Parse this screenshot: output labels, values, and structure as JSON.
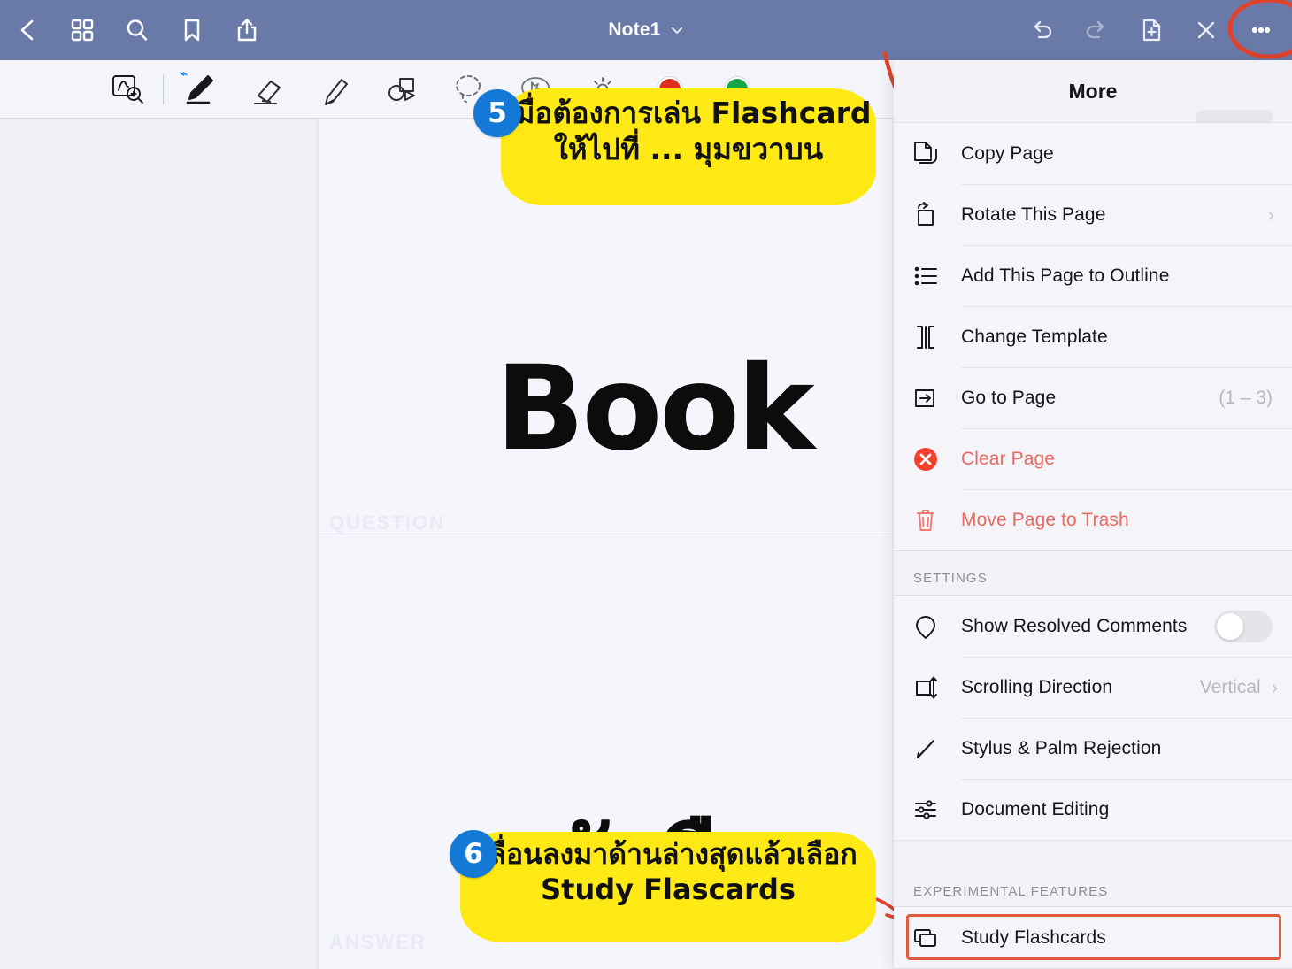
{
  "navbar": {
    "background": "#6a7aa8",
    "title": "Note1",
    "left_icons": [
      {
        "name": "back-icon",
        "label": "Back"
      },
      {
        "name": "grid-thumbnails-icon",
        "label": "Page Thumbnails"
      },
      {
        "name": "search-icon",
        "label": "Search"
      },
      {
        "name": "bookmark-icon",
        "label": "Bookmark"
      },
      {
        "name": "share-icon",
        "label": "Share"
      }
    ],
    "right_icons": [
      {
        "name": "undo-icon",
        "label": "Undo"
      },
      {
        "name": "redo-icon",
        "label": "Redo"
      },
      {
        "name": "add-page-icon",
        "label": "Add Page"
      },
      {
        "name": "close-tools-icon",
        "label": "Close"
      },
      {
        "name": "more-ellipsis-icon",
        "label": "More"
      }
    ]
  },
  "toolbar": {
    "background": "#f4f5f9",
    "tools": [
      {
        "name": "zoom-write-icon",
        "label": "Zoom Write"
      },
      {
        "name": "pen-icon",
        "label": "Pen",
        "badge": "bluetooth",
        "selected": true
      },
      {
        "name": "eraser-icon",
        "label": "Eraser"
      },
      {
        "name": "highlighter-icon",
        "label": "Highlighter"
      },
      {
        "name": "shapes-icon",
        "label": "Shapes"
      },
      {
        "name": "lasso-select-icon",
        "label": "Lasso Select"
      },
      {
        "name": "sticker-icon",
        "label": "Sticker"
      },
      {
        "name": "brightness-icon",
        "label": "Brightness"
      }
    ],
    "swatches": [
      {
        "name": "color-swatch-red",
        "color": "#e02d22"
      },
      {
        "name": "color-swatch-green",
        "color": "#13a84a"
      }
    ]
  },
  "page": {
    "question_label": "QUESTION",
    "answer_label": "ANSWER",
    "handwriting_front": "Book",
    "handwriting_back": "หนังสือ"
  },
  "annotations": {
    "accent_color": "#e05a3f",
    "highlight_color": "#ffe914",
    "badge_color": "#1479d6",
    "step5": {
      "number": "5",
      "line1": "เมื่อต้องการเล่น Flashcard",
      "line2": "ให้ไปที่ ... มุมขวาบน"
    },
    "step6": {
      "number": "6",
      "line1": "เลื่อนลงมาด้านล่างสุดแล้วเลือก",
      "line2": "Study Flascards"
    }
  },
  "more_menu": {
    "title": "More",
    "page_actions": [
      {
        "icon": "copy-page-icon",
        "label": "Copy Page",
        "value": "",
        "chevron": false,
        "danger": false
      },
      {
        "icon": "rotate-page-icon",
        "label": "Rotate This Page",
        "value": "",
        "chevron": true,
        "danger": false
      },
      {
        "icon": "outline-icon",
        "label": "Add This Page to Outline",
        "value": "",
        "chevron": false,
        "danger": false
      },
      {
        "icon": "change-template-icon",
        "label": "Change Template",
        "value": "",
        "chevron": false,
        "danger": false
      },
      {
        "icon": "go-to-page-icon",
        "label": "Go to Page",
        "value": "(1 – 3)",
        "chevron": false,
        "danger": false
      },
      {
        "icon": "clear-page-icon",
        "label": "Clear Page",
        "value": "",
        "chevron": false,
        "danger": true
      },
      {
        "icon": "trash-icon",
        "label": "Move Page to Trash",
        "value": "",
        "chevron": false,
        "danger": true
      }
    ],
    "settings_header": "SETTINGS",
    "settings": [
      {
        "icon": "comment-pin-icon",
        "label": "Show Resolved Comments",
        "control": "toggle",
        "toggle_on": false,
        "value": ""
      },
      {
        "icon": "scrolling-direction-icon",
        "label": "Scrolling Direction",
        "control": "value-chevron",
        "value": "Vertical"
      },
      {
        "icon": "stylus-icon",
        "label": "Stylus & Palm Rejection",
        "control": "none",
        "value": ""
      },
      {
        "icon": "document-editing-icon",
        "label": "Document Editing",
        "control": "none",
        "value": ""
      }
    ],
    "experimental_header": "EXPERIMENTAL FEATURES",
    "experimental": [
      {
        "icon": "flashcards-icon",
        "label": "Study Flashcards",
        "highlighted": true
      }
    ]
  }
}
